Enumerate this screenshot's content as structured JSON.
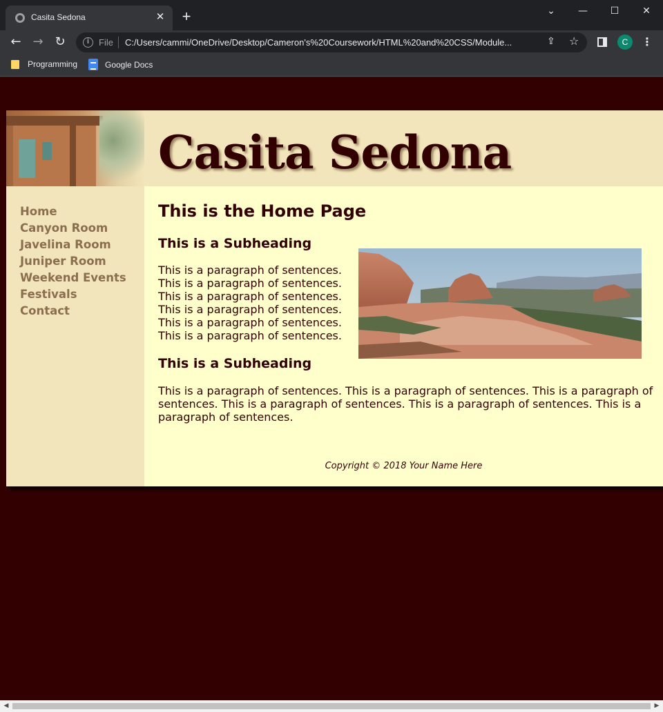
{
  "browser": {
    "tab_title": "Casita Sedona",
    "address_prefix": "File",
    "url": "C:/Users/cammi/OneDrive/Desktop/Cameron's%20Coursework/HTML%20and%20CSS/Module...",
    "profile_initial": "C",
    "bookmarks": [
      "Programming",
      "Google Docs"
    ]
  },
  "site": {
    "title": "Casita Sedona",
    "nav": [
      "Home",
      "Canyon Room",
      "Javelina Room",
      "Juniper Room",
      "Weekend Events",
      "Festivals",
      "Contact"
    ],
    "heading": "This is the Home Page",
    "subheading_1": "This is a Subheading",
    "paragraph_lines": [
      "This is a paragraph of sentences.",
      "This is a paragraph of sentences.",
      "This is a paragraph of sentences.",
      "This is a paragraph of sentences.",
      "This is a paragraph of sentences.",
      "This is a paragraph of sentences."
    ],
    "subheading_2": "This is a Subheading",
    "long_paragraph": "This is a paragraph of sentences. This is a paragraph of sentences. This is a paragraph of sentences. This is a paragraph of sentences. This is a paragraph of sentences. This is a paragraph of sentences.",
    "footer": "Copyright © 2018 Your Name Here"
  },
  "colors": {
    "page_bg": "#330000",
    "content_bg": "#ffffcc",
    "header_bg": "#f3e5bb",
    "nav_link": "#8b6d4f",
    "text": "#330000"
  },
  "icons": {
    "favicon": "globe-icon",
    "tab_close": "close-icon",
    "new_tab": "plus-icon",
    "back": "arrow-left-icon",
    "forward": "arrow-right-icon",
    "reload": "reload-icon",
    "site_info": "info-icon",
    "share": "share-icon",
    "bookmark": "star-icon",
    "side_panel": "side-panel-icon",
    "menu": "kebab-menu-icon"
  }
}
